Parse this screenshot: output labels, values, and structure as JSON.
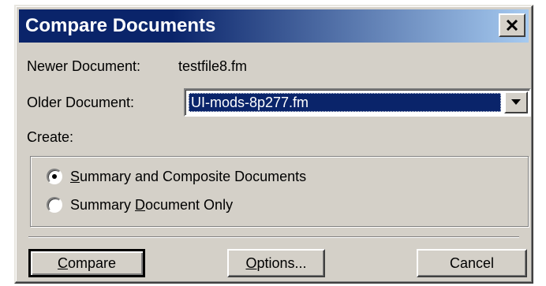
{
  "dialog": {
    "title": "Compare Documents",
    "close_icon": "close-icon"
  },
  "fields": {
    "newer_label": "Newer Document:",
    "newer_value": "testfile8.fm",
    "older_label": "Older Document:",
    "older_value": "UI-mods-8p277.fm"
  },
  "create": {
    "label": "Create:",
    "options": [
      {
        "mnemonic": "S",
        "rest": "ummary and Composite Documents",
        "checked": true
      },
      {
        "prefix": "Summary ",
        "mnemonic": "D",
        "rest": "ocument Only",
        "checked": false
      }
    ]
  },
  "buttons": {
    "compare_mnemonic": "C",
    "compare_rest": "ompare",
    "options_mnemonic": "O",
    "options_rest": "ptions...",
    "cancel": "Cancel"
  },
  "colors": {
    "title_bar": "#0a246a",
    "face": "#d4d0c8",
    "selection": "#0a246a"
  }
}
